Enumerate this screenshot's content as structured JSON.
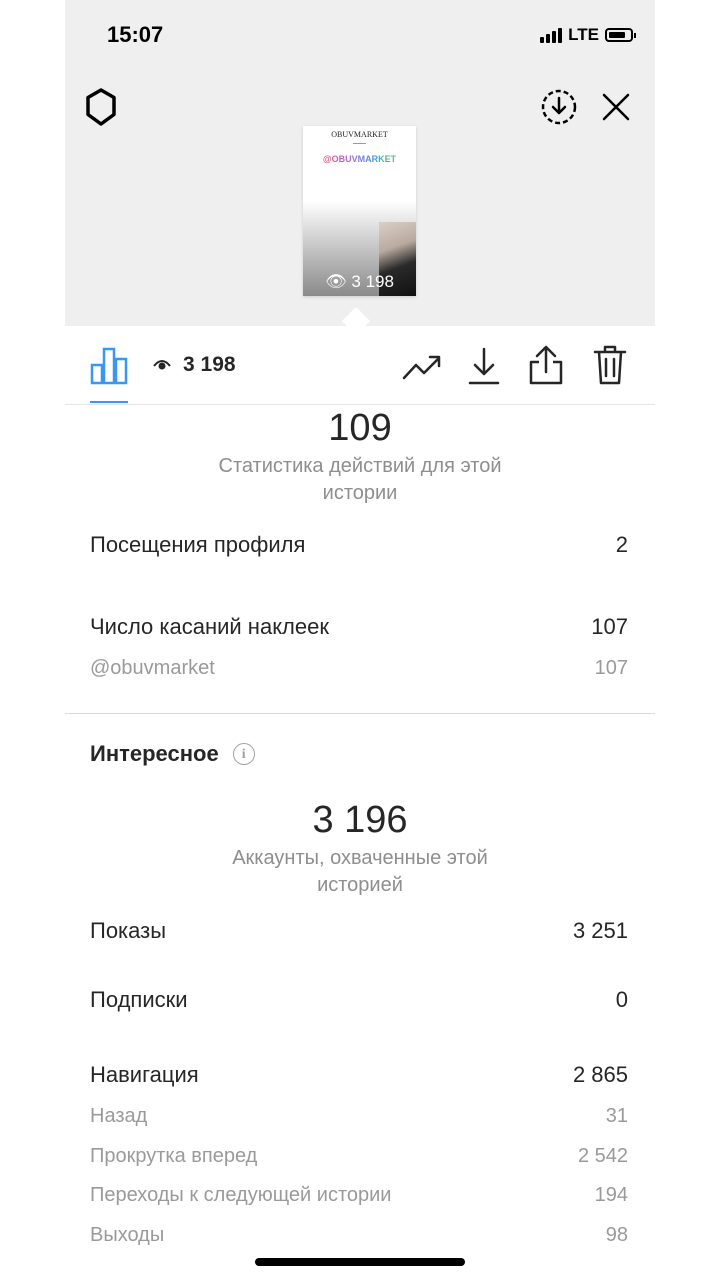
{
  "status_bar": {
    "time": "15:07",
    "network": "LTE"
  },
  "story_preview": {
    "brand": "OBUVMARKET",
    "handle": "@OBUVMARKET",
    "views": "3 198"
  },
  "tabbar": {
    "views": "3 198"
  },
  "actions": {
    "total": "109",
    "subtitle": "Статистика действий для этой истории"
  },
  "rows_actions": [
    {
      "label": "Посещения профиля",
      "value": "2"
    },
    {
      "label": "Число касаний наклеек",
      "value": "107"
    }
  ],
  "sticker_row": {
    "label": "@obuvmarket",
    "value": "107"
  },
  "discovery": {
    "title": "Интересное",
    "reach": "3 196",
    "reach_subtitle": "Аккаунты, охваченные этой историей",
    "rows": [
      {
        "label": "Показы",
        "value": "3 251"
      },
      {
        "label": "Подписки",
        "value": "0"
      },
      {
        "label": "Навигация",
        "value": "2 865"
      }
    ],
    "nav_rows": [
      {
        "label": "Назад",
        "value": "31"
      },
      {
        "label": "Прокрутка вперед",
        "value": "2 542"
      },
      {
        "label": "Переходы к следующей истории",
        "value": "194"
      },
      {
        "label": "Выходы",
        "value": "98"
      }
    ]
  },
  "colors": {
    "accent": "#3897f0",
    "text": "#262626",
    "secondary": "#8e8e8e"
  }
}
